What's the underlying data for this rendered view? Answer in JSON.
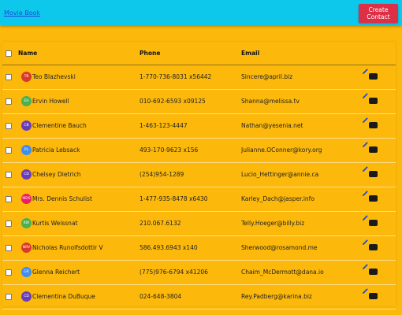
{
  "header": {
    "brand": "Movie Book",
    "create_button": "Create Contact"
  },
  "table": {
    "columns": [
      "Name",
      "Phone",
      "Email"
    ],
    "rows": [
      {
        "initials": "TB",
        "avatar_color": "#d93a2b",
        "name": "Teo Blazhevski",
        "phone": "1-770-736-8031 x56442",
        "email": "Sincere@april.biz"
      },
      {
        "initials": "EH",
        "avatar_color": "#4caf50",
        "name": "Ervin Howell",
        "phone": "010-692-6593 x09125",
        "email": "Shanna@melissa.tv"
      },
      {
        "initials": "CB",
        "avatar_color": "#6a3db8",
        "name": "Clementine Bauch",
        "phone": "1-463-123-4447",
        "email": "Nathan@yesenia.net"
      },
      {
        "initials": "PL",
        "avatar_color": "#3f8ef0",
        "name": "Patricia Lebsack",
        "phone": "493-170-9623 x156",
        "email": "Julianne.OConner@kory.org"
      },
      {
        "initials": "CD",
        "avatar_color": "#6a3db8",
        "name": "Chelsey Dietrich",
        "phone": "(254)954-1289",
        "email": "Lucio_Hettinger@annie.ca"
      },
      {
        "initials": "MDS",
        "avatar_color": "#e91e63",
        "name": "Mrs. Dennis Schulist",
        "phone": "1-477-935-8478 x6430",
        "email": "Karley_Dach@jasper.info"
      },
      {
        "initials": "KW",
        "avatar_color": "#4caf50",
        "name": "Kurtis Weissnat",
        "phone": "210.067.6132",
        "email": "Telly.Hoeger@billy.biz"
      },
      {
        "initials": "NRV",
        "avatar_color": "#d93a2b",
        "name": "Nicholas Runolfsdottir V",
        "phone": "586.493.6943 x140",
        "email": "Sherwood@rosamond.me"
      },
      {
        "initials": "GR",
        "avatar_color": "#3f8ef0",
        "name": "Glenna Reichert",
        "phone": "(775)976-6794 x41206",
        "email": "Chaim_McDermott@dana.io"
      },
      {
        "initials": "CD",
        "avatar_color": "#6a3db8",
        "name": "Clementina DuBuque",
        "phone": "024-648-3804",
        "email": "Rey.Padberg@karina.biz"
      }
    ]
  },
  "colors": {
    "header_bg": "#0ec8ec",
    "page_bg": "#fdb90b",
    "create_button_bg": "#dd2f45",
    "edit_icon": "#1a4bd8"
  },
  "icons": {
    "edit": "pencil-icon",
    "toggle": "toggle-switch"
  }
}
